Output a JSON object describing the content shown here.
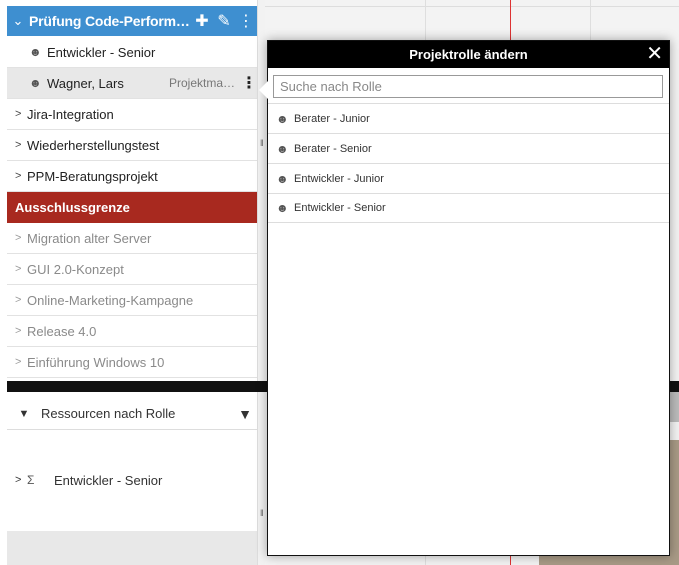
{
  "project": {
    "title": "Prüfung Code-Performa…",
    "add_icon": "plus-icon",
    "edit_icon": "pencil-icon",
    "menu_icon": "kebab-icon"
  },
  "assignments": [
    {
      "label": "Entwickler - Senior",
      "role": ""
    },
    {
      "label": "Wagner, Lars",
      "role": "Projektman…"
    }
  ],
  "projects": [
    {
      "label": "Jira-Integration",
      "muted": false
    },
    {
      "label": "Wiederherstellungstest",
      "muted": false
    },
    {
      "label": "PPM-Beratungsprojekt",
      "muted": false
    }
  ],
  "exclusion_boundary": "Ausschlussgrenze",
  "excluded_projects": [
    {
      "label": "Migration alter Server"
    },
    {
      "label": "GUI 2.0-Konzept"
    },
    {
      "label": "Online-Marketing-Kampagne"
    },
    {
      "label": "Release 4.0"
    },
    {
      "label": "Einführung Windows 10"
    }
  ],
  "resources": {
    "header": "Ressourcen nach Rolle",
    "items": [
      {
        "label": "Entwickler - Senior"
      }
    ]
  },
  "modal": {
    "title": "Projektrolle ändern",
    "search_placeholder": "Suche nach Rolle",
    "options": [
      {
        "label": "Berater - Junior"
      },
      {
        "label": "Berater - Senior"
      },
      {
        "label": "Entwickler - Junior"
      },
      {
        "label": "Entwickler - Senior"
      }
    ]
  },
  "colors": {
    "header_blue": "#3e8fd0",
    "exclusion_red": "#a8291f",
    "today_line": "#dd3333"
  }
}
